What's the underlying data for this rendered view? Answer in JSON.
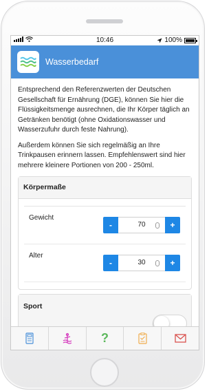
{
  "status_bar": {
    "time": "10:46",
    "battery": "100%"
  },
  "header": {
    "title": "Wasserbedarf",
    "icon": "water-waves-icon"
  },
  "intro": {
    "paragraph_1": "Entsprechend den Referenzwerten der Deutschen Gesellschaft für Ernährung (DGE), können Sie hier die Flüssigkeitsmenge ausrechnen, die Ihr Körper täglich an Getränken benötigt (ohne Oxidationswasser und Wasserzufuhr durch feste Nahrung).",
    "paragraph_2": "Außerdem können Sie sich regelmäßig an Ihre Trinkpausen erinnern lassen. Empfehlenswert sind hier mehrere kleinere Portionen von 200 - 250ml."
  },
  "body_measures": {
    "title": "Körpermaße",
    "weight": {
      "label": "Gewicht",
      "value": "70",
      "minus": "-",
      "plus": "+"
    },
    "age": {
      "label": "Alter",
      "value": "30",
      "minus": "-",
      "plus": "+"
    }
  },
  "sport": {
    "title": "Sport",
    "enabled": false
  },
  "tabs": [
    {
      "icon": "calculator-icon",
      "color": "#4a90d9"
    },
    {
      "icon": "water-glass-icon",
      "color": "#d63fbf"
    },
    {
      "icon": "question-icon",
      "label": "?",
      "color": "#5cb85c"
    },
    {
      "icon": "clipboard-icon",
      "color": "#f0ad4e"
    },
    {
      "icon": "mail-icon",
      "color": "#d9534f"
    }
  ],
  "colors": {
    "accent": "#4a90d9",
    "button": "#1e87e5"
  }
}
